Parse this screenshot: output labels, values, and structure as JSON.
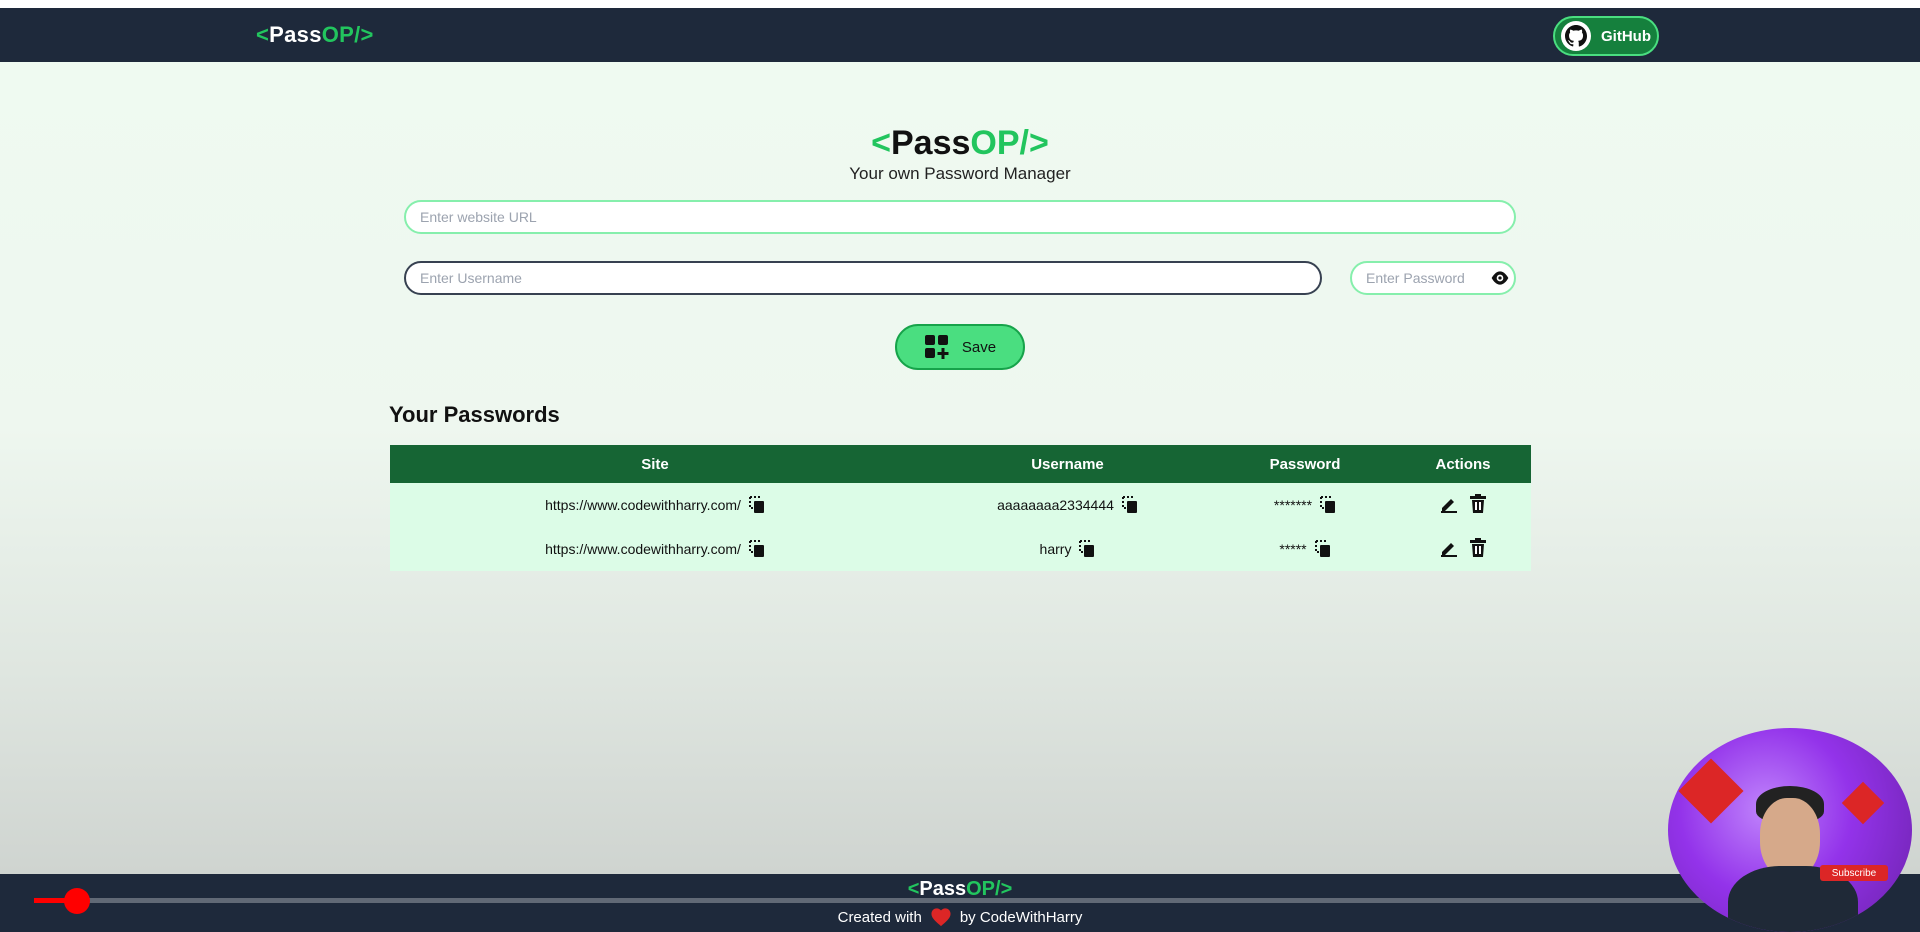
{
  "nav": {
    "logo_left": "<",
    "logo_pass": "Pass",
    "logo_op": "OP/>",
    "github_label": "GitHub"
  },
  "hero": {
    "logo_left": "<",
    "logo_pass": "Pass",
    "logo_op": "OP/>",
    "subtitle": "Your own Password Manager"
  },
  "form": {
    "url_placeholder": "Enter website URL",
    "username_placeholder": "Enter Username",
    "password_placeholder": "Enter Password",
    "save_label": "Save"
  },
  "passwords": {
    "title": "Your Passwords",
    "columns": [
      "Site",
      "Username",
      "Password",
      "Actions"
    ],
    "rows": [
      {
        "site": "https://www.codewithharry.com/",
        "username": "aaaaaaaa2334444",
        "password": "*******"
      },
      {
        "site": "https://www.codewithharry.com/",
        "username": "harry",
        "password": "*****"
      }
    ]
  },
  "footer": {
    "logo_left": "<",
    "logo_pass": "Pass",
    "logo_op": "OP/>",
    "created_with": "Created with",
    "by": "by CodeWithHarry"
  },
  "video": {
    "subscribe_label": "Subscribe",
    "progress_fraction": 0.02
  },
  "colors": {
    "accent": "#22c55e",
    "nav_bg": "#1e293b",
    "table_header": "#166534",
    "row_bg": "#dcfce7"
  }
}
